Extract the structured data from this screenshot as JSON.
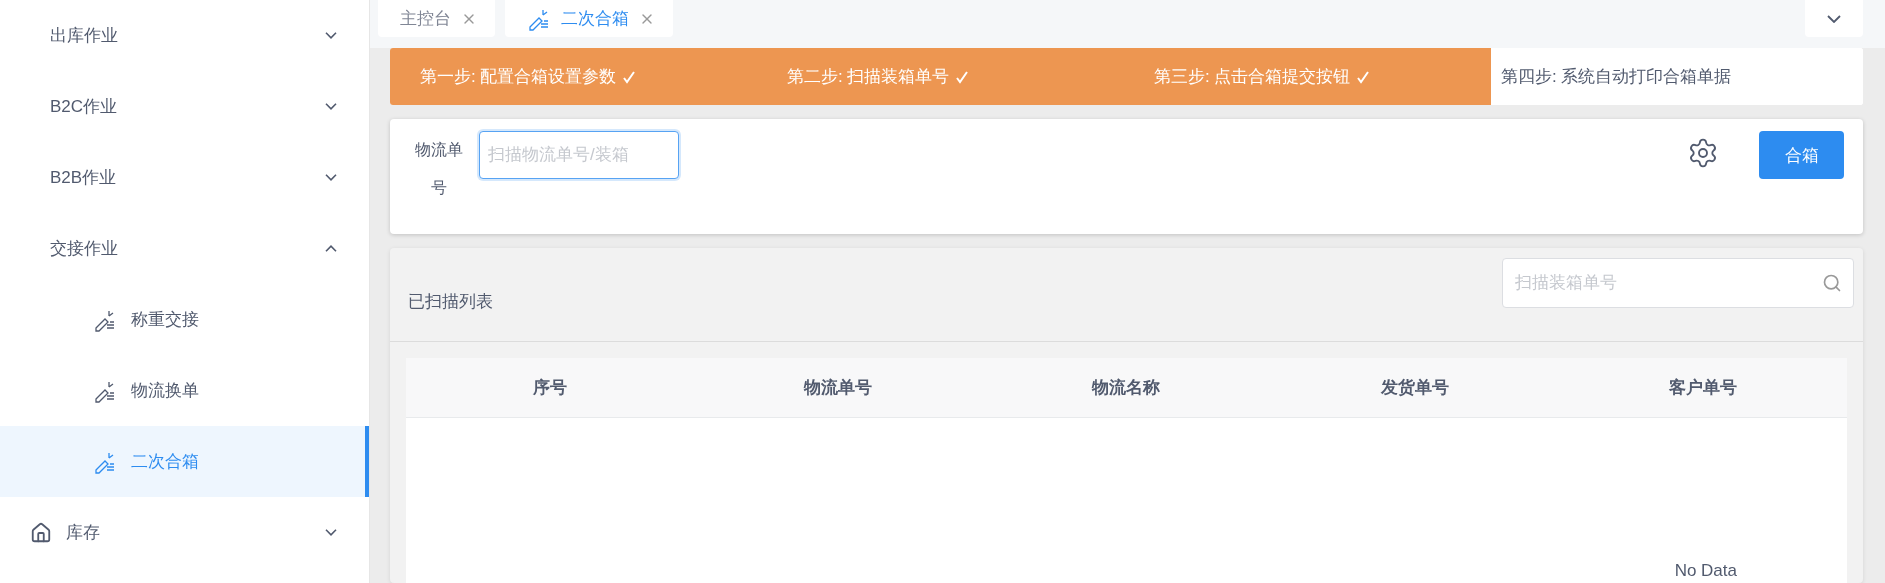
{
  "sidebar": {
    "items": [
      {
        "label": "出库作业",
        "expanded": false,
        "has_icon": false
      },
      {
        "label": "B2C作业",
        "expanded": false,
        "has_icon": false
      },
      {
        "label": "B2B作业",
        "expanded": false,
        "has_icon": false
      },
      {
        "label": "交接作业",
        "expanded": true,
        "has_icon": false,
        "children": [
          {
            "label": "称重交接",
            "selected": false
          },
          {
            "label": "物流换单",
            "selected": false
          },
          {
            "label": "二次合箱",
            "selected": true
          }
        ]
      },
      {
        "label": "库存",
        "expanded": false,
        "has_icon": true
      }
    ]
  },
  "tabs": [
    {
      "label": "主控台",
      "selected": false,
      "has_icon": false
    },
    {
      "label": "二次合箱",
      "selected": true,
      "has_icon": true
    }
  ],
  "steps": [
    {
      "label": "第一步: 配置合箱设置参数",
      "done": true
    },
    {
      "label": "第二步: 扫描装箱单号",
      "done": true
    },
    {
      "label": "第三步: 点击合箱提交按钮",
      "done": true
    },
    {
      "label": "第四步: 系统自动打印合箱单据",
      "done": false
    }
  ],
  "form": {
    "label": "物流单号",
    "placeholder": "扫描物流单号/装箱",
    "button": "合箱"
  },
  "list": {
    "title": "已扫描列表",
    "search_placeholder": "扫描装箱单号",
    "columns": [
      "序号",
      "物流单号",
      "物流名称",
      "发货单号",
      "客户单号"
    ],
    "empty_text": "No Data"
  }
}
